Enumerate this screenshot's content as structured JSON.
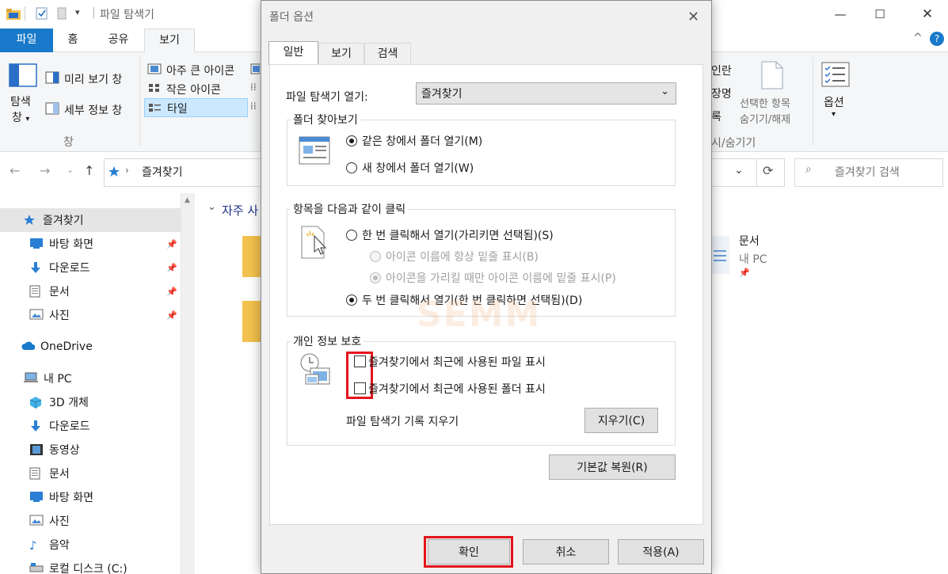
{
  "explorer": {
    "title": "파일 탐색기",
    "tabs": [
      {
        "label": "파일"
      },
      {
        "label": "홈"
      },
      {
        "label": "공유"
      },
      {
        "label": "보기"
      }
    ],
    "ribbon": {
      "navpane_label_1": "탐색",
      "navpane_label_2": "창",
      "preview_pane": "미리 보기 창",
      "details_pane": "세부 정보 창",
      "group_pane": "창",
      "layout_xl_icons": "아주 큰 아이콘",
      "layout_small_icons": "작은 아이콘",
      "layout_tiles": "타일",
      "partial_1": "인란",
      "partial_2": "장명",
      "partial_3": "록",
      "hide_selected_1": "선택한 항목",
      "hide_selected_2": "숨기기/해제",
      "group_showhide": "시/숨기기",
      "options": "옵션"
    },
    "address": {
      "path": "즐겨찾기",
      "search_placeholder": "즐겨찾기 검색"
    },
    "content": {
      "group_header": "자주 사",
      "doc_name": "문서",
      "doc_location": "내 PC"
    },
    "nav": [
      {
        "label": "즐겨찾기",
        "icon": "star-icon"
      },
      {
        "label": "바탕 화면",
        "icon": "desktop-icon"
      },
      {
        "label": "다운로드",
        "icon": "download-icon"
      },
      {
        "label": "문서",
        "icon": "document-icon"
      },
      {
        "label": "사진",
        "icon": "picture-icon"
      },
      {
        "label": "OneDrive",
        "icon": "cloud-icon"
      },
      {
        "label": "내 PC",
        "icon": "pc-icon"
      },
      {
        "label": "3D 개체",
        "icon": "cube-icon"
      },
      {
        "label": "다운로드",
        "icon": "download-icon"
      },
      {
        "label": "동영상",
        "icon": "video-icon"
      },
      {
        "label": "문서",
        "icon": "document-icon"
      },
      {
        "label": "바탕 화면",
        "icon": "desktop-icon"
      },
      {
        "label": "사진",
        "icon": "picture-icon"
      },
      {
        "label": "음악",
        "icon": "music-icon"
      },
      {
        "label": "로컬 디스크 (C:)",
        "icon": "drive-icon"
      }
    ]
  },
  "dialog": {
    "title": "폴더 옵션",
    "tabs": [
      {
        "label": "일반"
      },
      {
        "label": "보기"
      },
      {
        "label": "검색"
      }
    ],
    "open_explorer_label": "파일 탐색기 열기:",
    "open_explorer_value": "즐겨찾기",
    "browse_group": {
      "title": "폴더 찾아보기",
      "opt_same": "같은 창에서 폴더 열기(M)",
      "opt_new": "새 창에서 폴더 열기(W)"
    },
    "click_group": {
      "title": "항목을 다음과 같이 클릭",
      "opt_single": "한 번 클릭해서 열기(가리키면 선택됨)(S)",
      "opt_underline_always": "아이콘 이름에 항상 밑줄 표시(B)",
      "opt_underline_hover": "아이콘을 가리킬 때만 아이콘 이름에 밑줄 표시(P)",
      "opt_double": "두 번 클릭해서 열기(한 번 클릭하면 선택됨)(D)"
    },
    "privacy_group": {
      "title": "개인 정보 보호",
      "chk_recent_files": "즐겨찾기에서 최근에 사용된 파일 표시",
      "chk_recent_folders": "즐겨찾기에서 최근에 사용된 폴더 표시",
      "clear_label": "파일 탐색기 기록 지우기",
      "clear_button": "지우기(C)"
    },
    "restore_button": "기본값 복원(R)",
    "ok_button": "확인",
    "cancel_button": "취소",
    "apply_button": "적용(A)"
  },
  "watermark": "SEMM",
  "colors": {
    "accent": "#1979ca",
    "highlight_red": "#e4141c",
    "selection": "#cce8ff"
  }
}
